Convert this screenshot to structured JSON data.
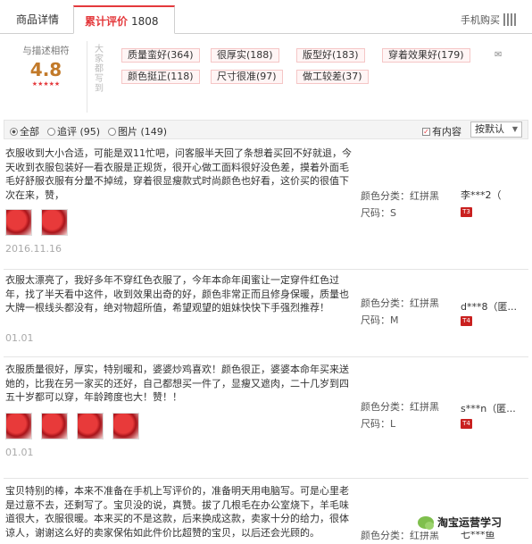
{
  "tabs": {
    "detail": "商品详情",
    "reviews": "累计评价",
    "reviews_count": "1808",
    "mobile_buy": "手机购买"
  },
  "rating": {
    "label": "与描述相符",
    "score": "4.8",
    "stars": "★★★★★",
    "tag_title": "大家都写到"
  },
  "tags": [
    "质量蛮好(364)",
    "很厚实(188)",
    "版型好(183)",
    "穿着效果好(179)",
    "颜色挺正(118)",
    "尺寸很准(97)",
    "做工较差(37)"
  ],
  "filter": {
    "all": "全部",
    "append": "追评 (95)",
    "images": "图片 (149)",
    "has_content": "有内容",
    "sort": "按默认"
  },
  "reviews": [
    {
      "text": "衣服收到大小合适，可能是双11忙吧，问客服半天回了条想着买回不好就退，今天收到衣服包装好一看衣服是正规货，很开心做工面料很好没色差，摸着外面毛毛好舒服衣服有分量不掉绒，穿着很显瘦款式时尚颜色也好看，这价买的很值下次在来，赞，",
      "date": "2016.11.16",
      "color": "颜色分类：红拼黑",
      "size": "尺码：S",
      "buyer": "李***2（",
      "level": "T3"
    },
    {
      "text": "衣服太漂亮了，我好多年不穿红色衣服了，今年本命年闺蜜让一定穿件红色过年，找了半天看中这件，收到效果出奇的好，颜色非常正而且修身保暖，质量也大牌一根线头都没有，绝对物超所值，希望观望的姐妹快快下手强烈推荐！",
      "date": "01.01",
      "color": "颜色分类：红拼黑",
      "size": "尺码：M",
      "buyer": "d***8（匿...",
      "level": "T4"
    },
    {
      "text": "衣服质量很好，厚实，特别暖和，婆婆炒鸡喜欢！颜色很正，婆婆本命年买来送她的，比我在另一家买的还好，自己都想买一件了，显瘦又遮肉，二十几岁到四五十岁都可以穿，年龄跨度也大！赞！！",
      "date": "01.01",
      "color": "颜色分类：红拼黑",
      "size": "尺码：L",
      "buyer": "s***n（匿...",
      "level": "T4"
    },
    {
      "text": "宝贝特别的棒，本来不准备在手机上写评价的，准备明天用电脑写。可是心里老是过意不去，还剩写了。宝贝没的说，真赞。拔了几根毛在办公室烧下，羊毛味道很大，衣服很暖。本来买的不是这款，后来换成这款，卖家十分的给力，很体谅人，谢谢这么好的卖家保佑如此件价比超赞的宝贝，以后还会光顾的。",
      "color": "颜色分类：红拼黑",
      "buyer": "七***鱼"
    }
  ],
  "watermark": "淘宝运营学习"
}
